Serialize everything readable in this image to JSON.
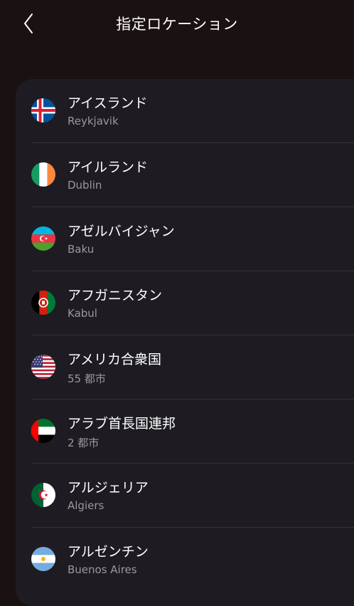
{
  "header": {
    "title": "指定ロケーション",
    "back_icon": "chevron-left-icon"
  },
  "colors": {
    "background": "#1a1112",
    "panel": "#1e1c22",
    "divider": "#34323a",
    "primary_text": "#ffffff",
    "secondary_text": "#9a989e"
  },
  "locations": [
    {
      "country": "アイスランド",
      "sub": "Reykjavik",
      "flag_icon": "iceland-flag-icon"
    },
    {
      "country": "アイルランド",
      "sub": "Dublin",
      "flag_icon": "ireland-flag-icon"
    },
    {
      "country": "アゼルバイジャン",
      "sub": "Baku",
      "flag_icon": "azerbaijan-flag-icon"
    },
    {
      "country": "アフガニスタン",
      "sub": "Kabul",
      "flag_icon": "afghanistan-flag-icon"
    },
    {
      "country": "アメリカ合衆国",
      "sub": "55 都市",
      "flag_icon": "usa-flag-icon"
    },
    {
      "country": "アラブ首長国連邦",
      "sub": "2 都市",
      "flag_icon": "uae-flag-icon"
    },
    {
      "country": "アルジェリア",
      "sub": "Algiers",
      "flag_icon": "algeria-flag-icon"
    },
    {
      "country": "アルゼンチン",
      "sub": "Buenos Aires",
      "flag_icon": "argentina-flag-icon"
    }
  ]
}
